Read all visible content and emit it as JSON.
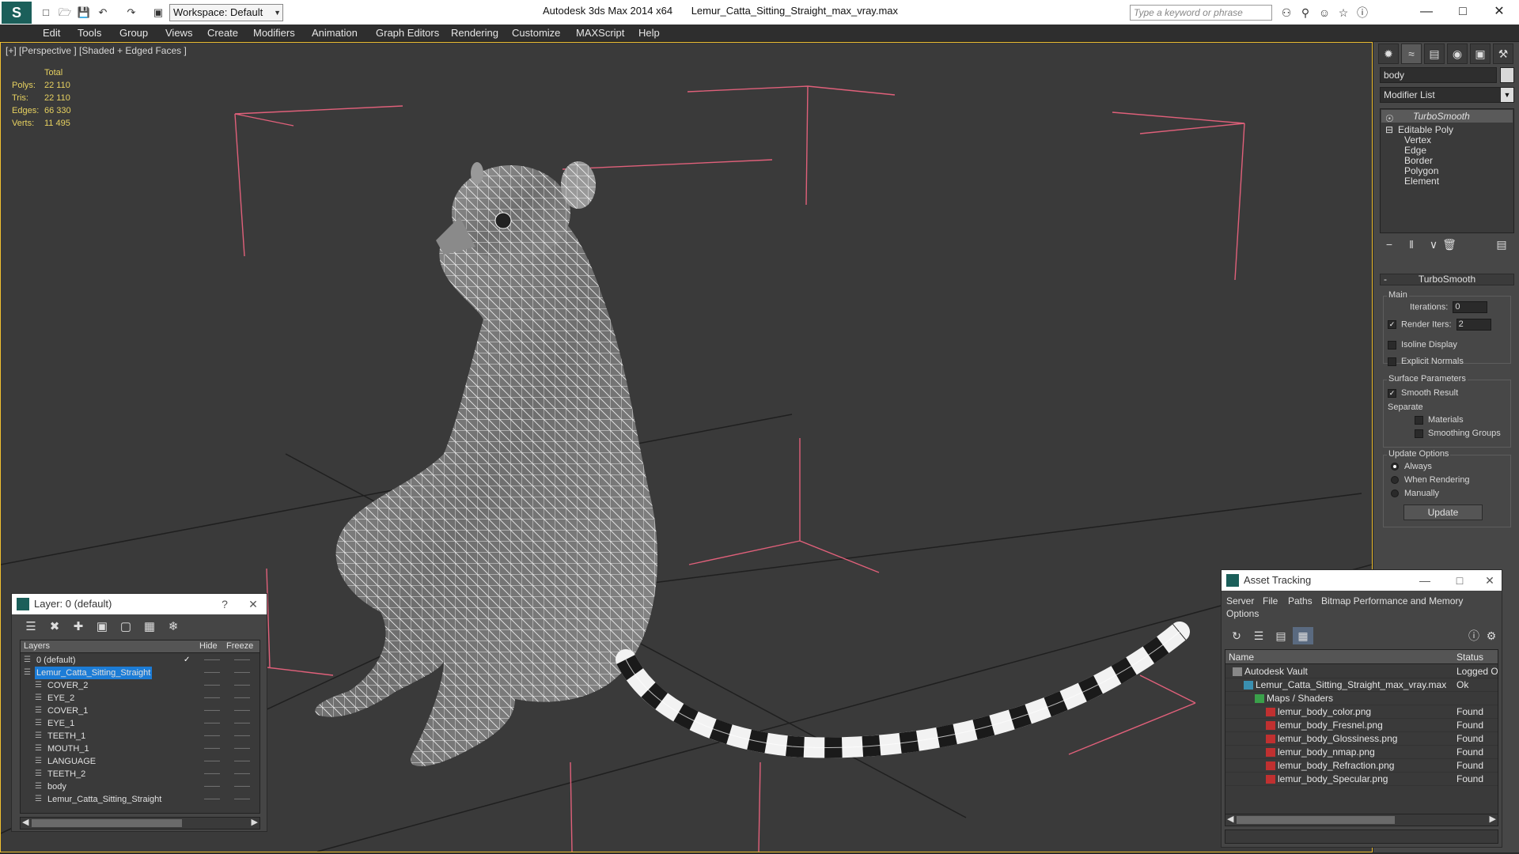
{
  "titlebar": {
    "workspace": "Workspace: Default",
    "app_title": "Autodesk 3ds Max  2014 x64",
    "file_title": "Lemur_Catta_Sitting_Straight_max_vray.max",
    "search_placeholder": "Type a keyword or phrase",
    "colors": {
      "titlebar_bg": "#ffffff",
      "logo_bg": "#1b5f5a"
    }
  },
  "menu": [
    "Edit",
    "Tools",
    "Group",
    "Views",
    "Create",
    "Modifiers",
    "Animation",
    "Graph Editors",
    "Rendering",
    "Customize",
    "MAXScript",
    "Help"
  ],
  "viewport": {
    "label": "[+] [Perspective ] [Shaded + Edged Faces ]",
    "stats": {
      "header": "Total",
      "rows": [
        {
          "label": "Polys:",
          "value": "22 110"
        },
        {
          "label": "Tris:",
          "value": "22 110"
        },
        {
          "label": "Edges:",
          "value": "66 330"
        },
        {
          "label": "Verts:",
          "value": "11 495"
        }
      ]
    },
    "colors": {
      "background": "#3a3a3a",
      "active_border": "#f0c030",
      "stats_text": "#e7d160",
      "bounding_box": "#e0607a"
    }
  },
  "command_panel": {
    "object_name": "body",
    "modifier_list": "Modifier List",
    "stack": {
      "turbosmooth": "TurboSmooth",
      "editable_poly": "Editable Poly",
      "subobjects": [
        "Vertex",
        "Edge",
        "Border",
        "Polygon",
        "Element"
      ]
    },
    "rollout": {
      "title": "TurboSmooth",
      "main": "Main",
      "iterations_label": "Iterations:",
      "iterations_value": "0",
      "render_iters_label": "Render Iters:",
      "render_iters_value": "2",
      "render_iters_checked": true,
      "isoline": "Isoline Display",
      "explicit_normals": "Explicit Normals",
      "surface_params": "Surface Parameters",
      "smooth_result": "Smooth Result",
      "smooth_result_checked": true,
      "separate": "Separate",
      "materials": "Materials",
      "smoothing_groups": "Smoothing Groups",
      "update_options": "Update Options",
      "always": "Always",
      "when_rendering": "When Rendering",
      "manually": "Manually",
      "selected_update_option": "Always",
      "update_button": "Update"
    }
  },
  "layer_window": {
    "title": "Layer: 0 (default)",
    "help": "?",
    "columns": {
      "layers": "Layers",
      "hide": "Hide",
      "freeze": "Freeze"
    },
    "rows": [
      {
        "name": "0 (default)",
        "level": 0,
        "selected": false,
        "check": "✓"
      },
      {
        "name": "Lemur_Catta_Sitting_Straight",
        "level": 0,
        "selected": true,
        "check": ""
      },
      {
        "name": "COVER_2",
        "level": 1,
        "selected": false,
        "check": ""
      },
      {
        "name": "EYE_2",
        "level": 1,
        "selected": false,
        "check": ""
      },
      {
        "name": "COVER_1",
        "level": 1,
        "selected": false,
        "check": ""
      },
      {
        "name": "EYE_1",
        "level": 1,
        "selected": false,
        "check": ""
      },
      {
        "name": "TEETH_1",
        "level": 1,
        "selected": false,
        "check": ""
      },
      {
        "name": "MOUTH_1",
        "level": 1,
        "selected": false,
        "check": ""
      },
      {
        "name": "LANGUAGE",
        "level": 1,
        "selected": false,
        "check": ""
      },
      {
        "name": "TEETH_2",
        "level": 1,
        "selected": false,
        "check": ""
      },
      {
        "name": "body",
        "level": 1,
        "selected": false,
        "check": ""
      },
      {
        "name": "Lemur_Catta_Sitting_Straight",
        "level": 1,
        "selected": false,
        "check": ""
      }
    ]
  },
  "asset_window": {
    "title": "Asset Tracking",
    "menu": [
      "Server",
      "File",
      "Paths",
      "Bitmap Performance and Memory",
      "Options"
    ],
    "columns": {
      "name": "Name",
      "status": "Status"
    },
    "rows": [
      {
        "name": "Autodesk Vault",
        "status": "Logged Out",
        "level": 0,
        "icon": "vault-icon"
      },
      {
        "name": "Lemur_Catta_Sitting_Straight_max_vray.max",
        "status": "Ok",
        "level": 1,
        "icon": "max-file-icon"
      },
      {
        "name": "Maps / Shaders",
        "status": "",
        "level": 2,
        "icon": "maps-icon"
      },
      {
        "name": "lemur_body_color.png",
        "status": "Found",
        "level": 3,
        "icon": "png-icon"
      },
      {
        "name": "lemur_body_Fresnel.png",
        "status": "Found",
        "level": 3,
        "icon": "png-icon"
      },
      {
        "name": "lemur_body_Glossiness.png",
        "status": "Found",
        "level": 3,
        "icon": "png-icon"
      },
      {
        "name": "lemur_body_nmap.png",
        "status": "Found",
        "level": 3,
        "icon": "png-icon"
      },
      {
        "name": "lemur_body_Refraction.png",
        "status": "Found",
        "level": 3,
        "icon": "png-icon"
      },
      {
        "name": "lemur_body_Specular.png",
        "status": "Found",
        "level": 3,
        "icon": "png-icon"
      }
    ]
  }
}
